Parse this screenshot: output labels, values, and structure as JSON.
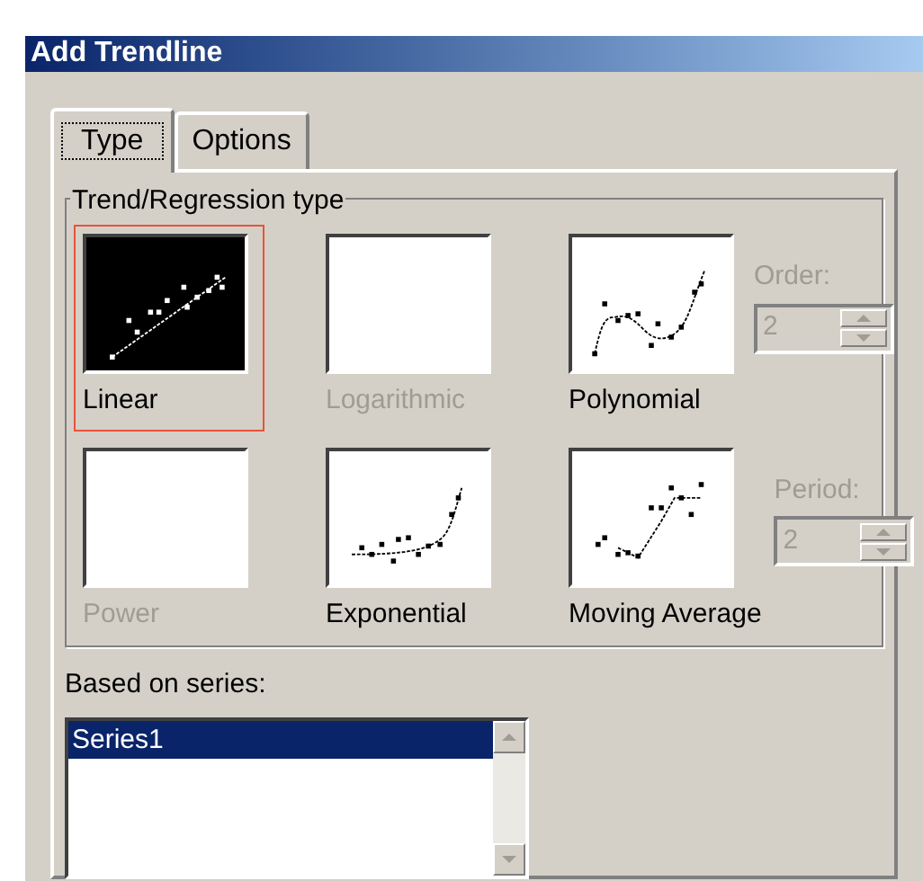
{
  "window": {
    "title": "Add Trendline"
  },
  "tabs": [
    {
      "label": "Type",
      "selected": true
    },
    {
      "label": "Options",
      "selected": false
    }
  ],
  "group": {
    "title": "Trend/Regression type"
  },
  "types": [
    {
      "kind": "linear",
      "label": "Linear",
      "selected": true,
      "disabled": false
    },
    {
      "label": "Logarithmic",
      "selected": false,
      "disabled": true
    },
    {
      "kind": "polynomial",
      "label": "Polynomial",
      "selected": false,
      "disabled": false,
      "spinner": {
        "label": "Order:",
        "value": "2",
        "disabled": true
      }
    },
    {
      "label": "Power",
      "selected": false,
      "disabled": true
    },
    {
      "kind": "exponential",
      "label": "Exponential",
      "selected": false,
      "disabled": false
    },
    {
      "kind": "moving_average",
      "label": "Moving Average",
      "selected": false,
      "disabled": false,
      "spinner": {
        "label": "Period:",
        "value": "2",
        "disabled": true
      }
    }
  ],
  "series": {
    "label": "Based on series:",
    "items": [
      {
        "label": "Series1",
        "selected": true
      }
    ]
  }
}
